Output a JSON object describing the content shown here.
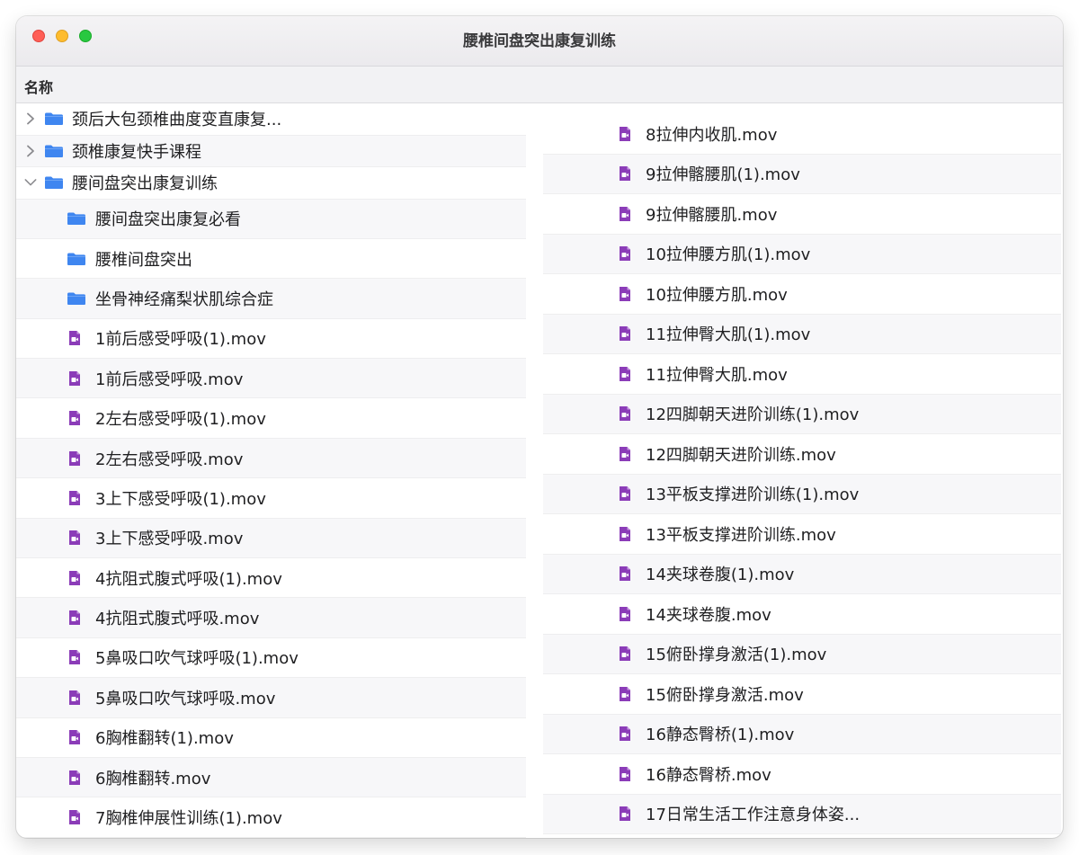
{
  "window": {
    "title": "腰椎间盘突出康复训练"
  },
  "header": {
    "name_column": "名称"
  },
  "colors": {
    "folder": "#3f86f0",
    "file": "#8b3cb8"
  },
  "left_rows": [
    {
      "label": "颈后大包颈椎曲度变直康复...",
      "type": "folder",
      "level": 0,
      "disclosure": "collapsed"
    },
    {
      "label": "颈椎康复快手课程",
      "type": "folder",
      "level": 0,
      "disclosure": "collapsed"
    },
    {
      "label": "腰间盘突出康复训练",
      "type": "folder",
      "level": 0,
      "disclosure": "expanded"
    },
    {
      "label": "腰间盘突出康复必看",
      "type": "folder",
      "level": 1
    },
    {
      "label": "腰椎间盘突出",
      "type": "folder",
      "level": 1
    },
    {
      "label": "坐骨神经痛梨状肌综合症",
      "type": "folder",
      "level": 1
    },
    {
      "label": "1前后感受呼吸(1).mov",
      "type": "file",
      "level": 1
    },
    {
      "label": "1前后感受呼吸.mov",
      "type": "file",
      "level": 1
    },
    {
      "label": "2左右感受呼吸(1).mov",
      "type": "file",
      "level": 1
    },
    {
      "label": "2左右感受呼吸.mov",
      "type": "file",
      "level": 1
    },
    {
      "label": "3上下感受呼吸(1).mov",
      "type": "file",
      "level": 1
    },
    {
      "label": "3上下感受呼吸.mov",
      "type": "file",
      "level": 1
    },
    {
      "label": "4抗阻式腹式呼吸(1).mov",
      "type": "file",
      "level": 1
    },
    {
      "label": "4抗阻式腹式呼吸.mov",
      "type": "file",
      "level": 1
    },
    {
      "label": "5鼻吸口吹气球呼吸(1).mov",
      "type": "file",
      "level": 1
    },
    {
      "label": "5鼻吸口吹气球呼吸.mov",
      "type": "file",
      "level": 1
    },
    {
      "label": "6胸椎翻转(1).mov",
      "type": "file",
      "level": 1
    },
    {
      "label": "6胸椎翻转.mov",
      "type": "file",
      "level": 1
    },
    {
      "label": "7胸椎伸展性训练(1).mov",
      "type": "file",
      "level": 1
    }
  ],
  "right_rows": [
    {
      "label": "8拉伸内收肌.mov",
      "type": "file"
    },
    {
      "label": "9拉伸髂腰肌(1).mov",
      "type": "file"
    },
    {
      "label": "9拉伸髂腰肌.mov",
      "type": "file"
    },
    {
      "label": "10拉伸腰方肌(1).mov",
      "type": "file"
    },
    {
      "label": "10拉伸腰方肌.mov",
      "type": "file"
    },
    {
      "label": "11拉伸臀大肌(1).mov",
      "type": "file"
    },
    {
      "label": "11拉伸臀大肌.mov",
      "type": "file"
    },
    {
      "label": "12四脚朝天进阶训练(1).mov",
      "type": "file"
    },
    {
      "label": "12四脚朝天进阶训练.mov",
      "type": "file"
    },
    {
      "label": "13平板支撑进阶训练(1).mov",
      "type": "file"
    },
    {
      "label": "13平板支撑进阶训练.mov",
      "type": "file"
    },
    {
      "label": "14夹球卷腹(1).mov",
      "type": "file"
    },
    {
      "label": "14夹球卷腹.mov",
      "type": "file"
    },
    {
      "label": "15俯卧撑身激活(1).mov",
      "type": "file"
    },
    {
      "label": "15俯卧撑身激活.mov",
      "type": "file"
    },
    {
      "label": "16静态臀桥(1).mov",
      "type": "file"
    },
    {
      "label": "16静态臀桥.mov",
      "type": "file"
    },
    {
      "label": "17日常生活工作注意身体姿...",
      "type": "file"
    }
  ]
}
